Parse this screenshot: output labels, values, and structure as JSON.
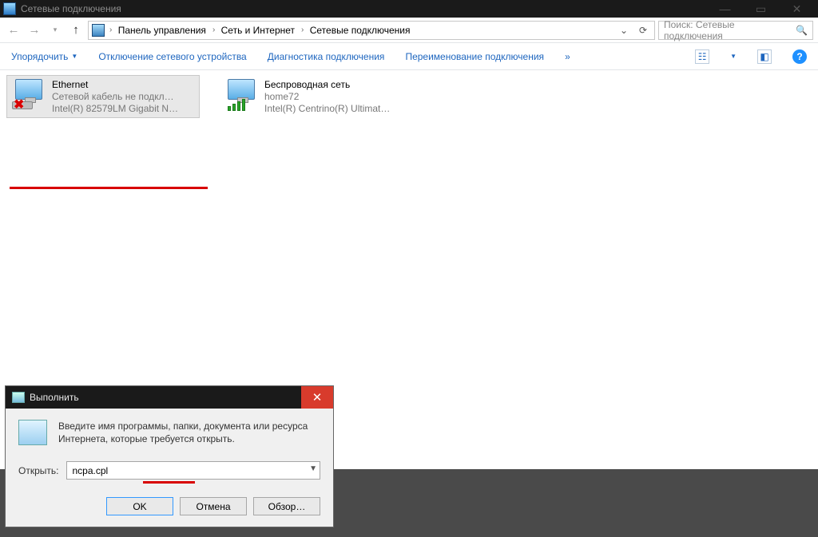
{
  "titlebar": {
    "title": "Сетевые подключения"
  },
  "breadcrumb": {
    "items": [
      "Панель управления",
      "Сеть и Интернет",
      "Сетевые подключения"
    ]
  },
  "search": {
    "placeholder": "Поиск: Сетевые подключения"
  },
  "cmdbar": {
    "organize": "Упорядочить",
    "disable": "Отключение сетевого устройства",
    "diagnose": "Диагностика подключения",
    "rename": "Переименование подключения",
    "more": "»"
  },
  "connections": {
    "ethernet": {
      "title": "Ethernet",
      "status": "Сетевой кабель не подкл…",
      "adapter": "Intel(R) 82579LM Gigabit N…"
    },
    "wifi": {
      "title": "Беспроводная сеть",
      "status": "home72",
      "adapter": "Intel(R) Centrino(R) Ultimat…"
    }
  },
  "run": {
    "title": "Выполнить",
    "description": "Введите имя программы, папки, документа или ресурса Интернета, которые требуется открыть.",
    "label": "Открыть:",
    "value": "ncpa.cpl",
    "ok": "OK",
    "cancel": "Отмена",
    "browse": "Обзор…"
  }
}
